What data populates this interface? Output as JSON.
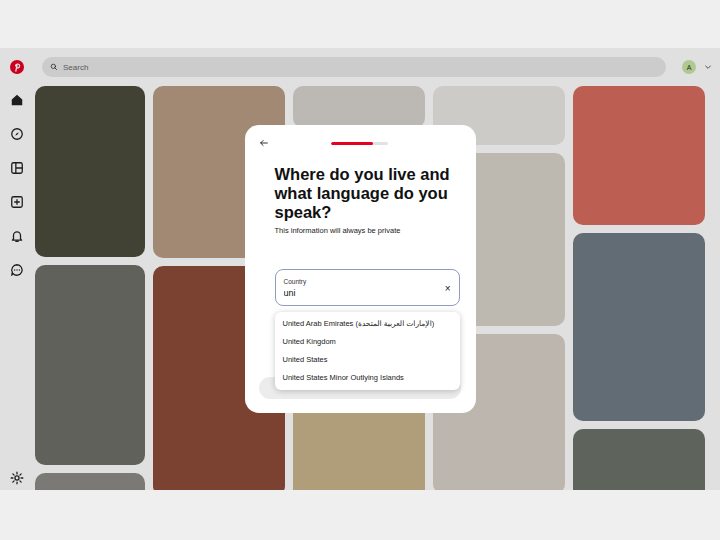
{
  "topbar": {
    "search": {
      "placeholder": "Search"
    },
    "avatar": "A"
  },
  "modal": {
    "progress": {
      "level": 0.75
    },
    "title": "Where do you live and what language do you speak?",
    "subtitle": "This information will always be private",
    "country_field": {
      "label": "Country",
      "value": "uni",
      "clear": "×"
    },
    "suggestions": [
      {
        "label": "United Arab Emirates (الإمارات العربية المتحدة)",
        "selected": false
      },
      {
        "label": "United Kingdom",
        "selected": false
      },
      {
        "label": "United States",
        "selected": false
      },
      {
        "label": "United States Minor Outlying Islands",
        "selected": false
      }
    ]
  }
}
